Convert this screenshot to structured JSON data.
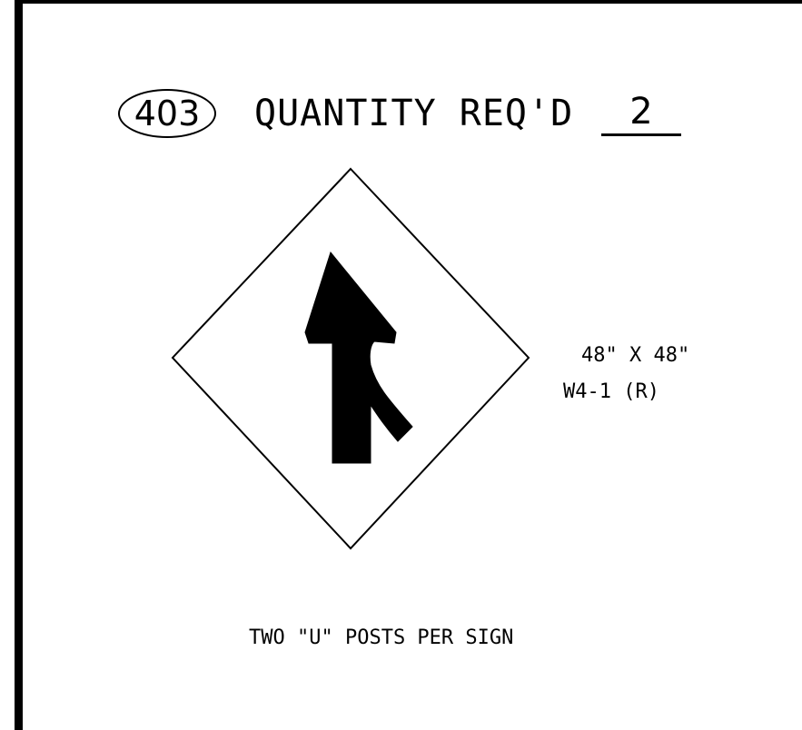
{
  "header": {
    "sign_number": "403",
    "quantity_label": "QUANTITY REQ'D",
    "quantity_value": "2"
  },
  "sign": {
    "shape": "diamond",
    "symbol": "merge-arrow-icon",
    "fill_color": "#ffffff",
    "symbol_color": "#000000"
  },
  "spec": {
    "size": "48\" X 48\"",
    "code": "W4-1 (R)"
  },
  "note": "TWO \"U\" POSTS PER SIGN"
}
